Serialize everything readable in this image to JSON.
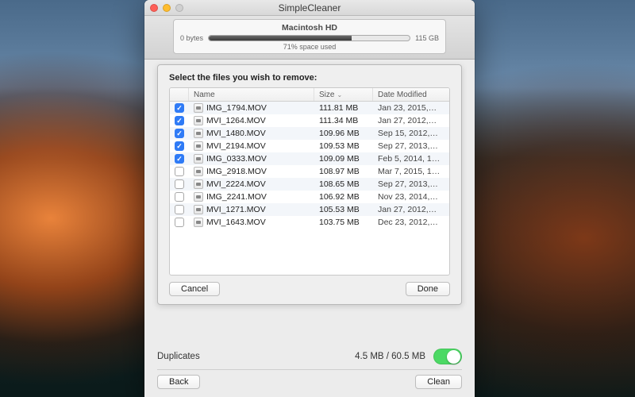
{
  "app": {
    "title": "SimpleCleaner"
  },
  "disk": {
    "name": "Macintosh HD",
    "used_label": "0 bytes",
    "total_label": "115 GB",
    "pct_label": "71% space used",
    "pct_fill": 71
  },
  "sheet": {
    "heading": "Select the files you wish to remove:",
    "columns": {
      "name": "Name",
      "size": "Size",
      "date": "Date Modified"
    },
    "cancel": "Cancel",
    "done": "Done"
  },
  "files": [
    {
      "checked": true,
      "name": "IMG_1794.MOV",
      "size": "111.81 MB",
      "date": "Jan 23, 2015,…"
    },
    {
      "checked": true,
      "name": "MVI_1264.MOV",
      "size": "111.34 MB",
      "date": "Jan 27, 2012,…"
    },
    {
      "checked": true,
      "name": "MVI_1480.MOV",
      "size": "109.96 MB",
      "date": "Sep 15, 2012,…"
    },
    {
      "checked": true,
      "name": "MVI_2194.MOV",
      "size": "109.53 MB",
      "date": "Sep 27, 2013,…"
    },
    {
      "checked": true,
      "name": "IMG_0333.MOV",
      "size": "109.09 MB",
      "date": "Feb 5, 2014, 1…"
    },
    {
      "checked": false,
      "name": "IMG_2918.MOV",
      "size": "108.97 MB",
      "date": "Mar 7, 2015, 1…"
    },
    {
      "checked": false,
      "name": "MVI_2224.MOV",
      "size": "108.65 MB",
      "date": "Sep 27, 2013,…"
    },
    {
      "checked": false,
      "name": "IMG_2241.MOV",
      "size": "106.92 MB",
      "date": "Nov 23, 2014,…"
    },
    {
      "checked": false,
      "name": "MVI_1271.MOV",
      "size": "105.53 MB",
      "date": "Jan 27, 2012,…"
    },
    {
      "checked": false,
      "name": "MVI_1643.MOV",
      "size": "103.75 MB",
      "date": "Dec 23, 2012,…"
    }
  ],
  "duplicates": {
    "label": "Duplicates",
    "stats": "4.5 MB / 60.5 MB",
    "enabled": true
  },
  "footer": {
    "back": "Back",
    "clean": "Clean"
  }
}
